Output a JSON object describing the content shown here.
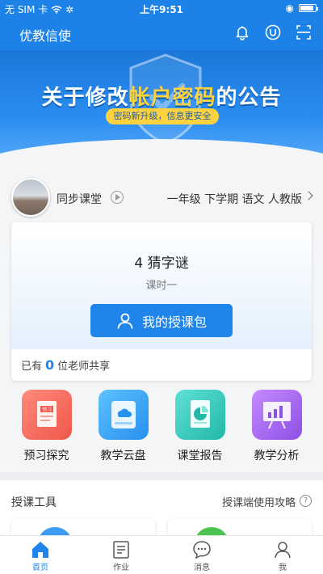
{
  "status_bar": {
    "carrier": "无 SIM 卡",
    "time": "上午9:51"
  },
  "header": {
    "title": "优教信使",
    "icons": [
      "bell-icon",
      "user-circle-icon",
      "scan-icon"
    ]
  },
  "banner": {
    "headline_prefix": "关于修改",
    "headline_highlight": "帐户密码",
    "headline_suffix": "的公告",
    "pill_text": "密码新升级，信息更安全",
    "slide_count": 5,
    "active_slide": 3
  },
  "sync": {
    "label": "同步课堂",
    "grade_info": "一年级 下学期 语文 人教版"
  },
  "lesson_card": {
    "title": "4 猜字谜",
    "subtitle": "课时一",
    "button_label": "我的授课包",
    "share_prefix": "已有",
    "share_count": "0",
    "share_suffix": "位老师共享"
  },
  "features": [
    {
      "label": "预习探究",
      "icon": "preview-doc-icon",
      "tile_text": "预习"
    },
    {
      "label": "教学云盘",
      "icon": "cloud-disk-icon"
    },
    {
      "label": "课堂报告",
      "icon": "report-doc-icon"
    },
    {
      "label": "教学分析",
      "icon": "analysis-board-icon"
    }
  ],
  "tools": {
    "title": "授课工具",
    "guide_label": "授课端使用攻略",
    "help_glyph": "?"
  },
  "tabbar": [
    {
      "label": "首页",
      "icon": "home-icon",
      "active": true
    },
    {
      "label": "作业",
      "icon": "homework-icon",
      "active": false
    },
    {
      "label": "消息",
      "icon": "message-icon",
      "active": false
    },
    {
      "label": "我",
      "icon": "profile-icon",
      "active": false
    }
  ],
  "colors": {
    "primary": "#1f85eb",
    "header": "#1d82e8",
    "highlight": "#ffd23f"
  }
}
